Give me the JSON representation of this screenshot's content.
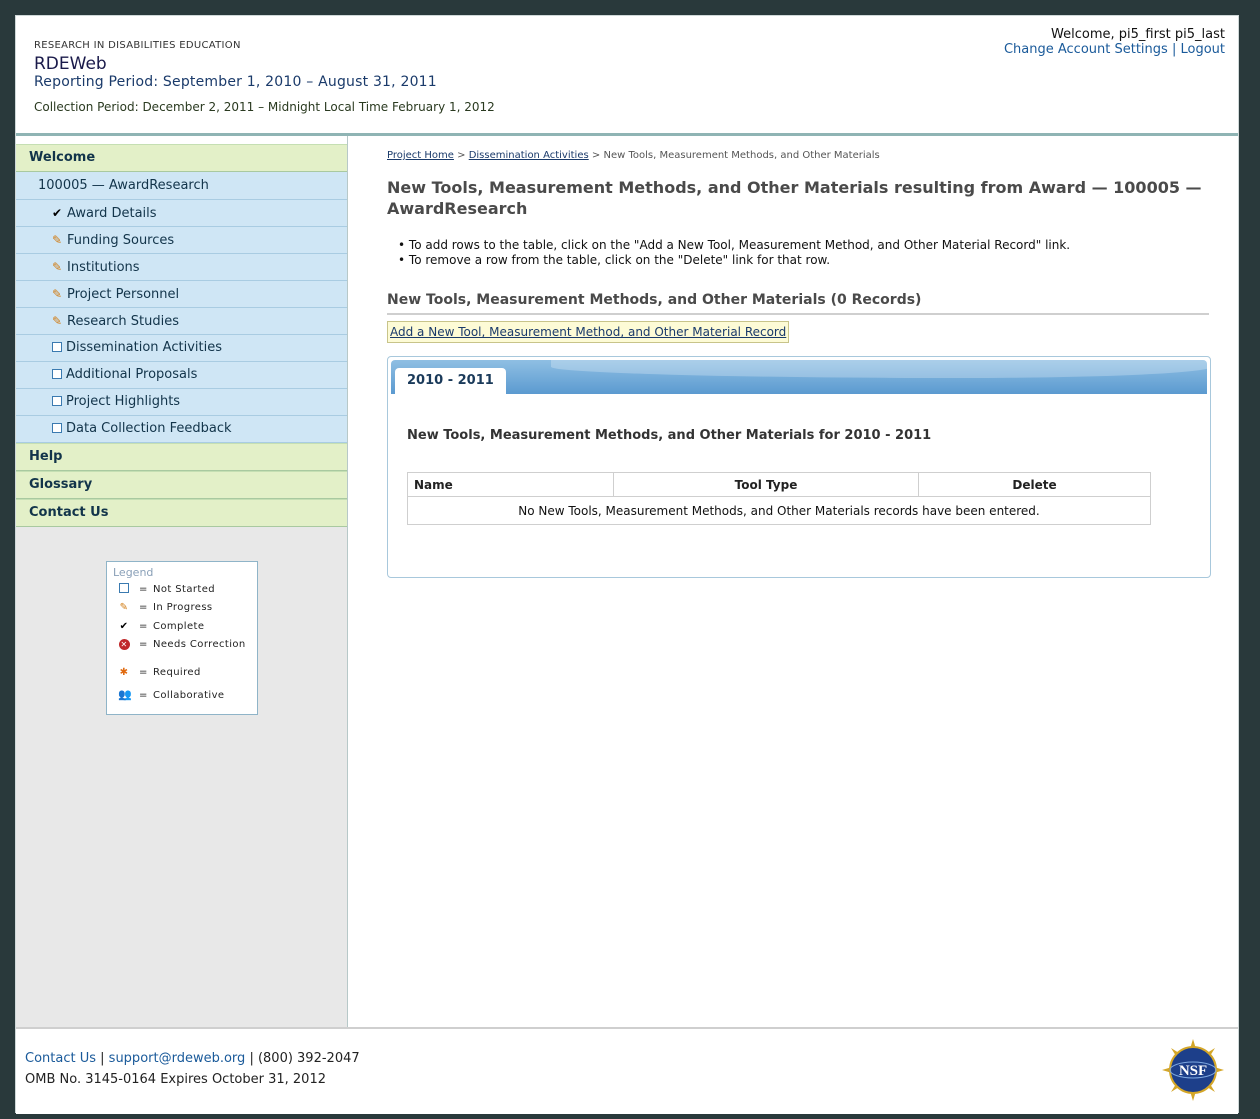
{
  "header": {
    "brand_top": "RESEARCH IN DISABILITIES EDUCATION",
    "brand_name": "RDEWeb",
    "reporting_period": "Reporting Period: September 1, 2010 – August 31, 2011",
    "collection_period": "Collection Period: December 2, 2011 – Midnight Local Time February 1, 2012",
    "welcome": "Welcome, pi5_first pi5_last",
    "change_account": "Change Account Settings",
    "separator": "|",
    "logout": "Logout"
  },
  "sidebar": {
    "welcome": "Welcome",
    "award": "100005 — AwardResearch",
    "items": [
      {
        "label": "Award Details",
        "status": "complete"
      },
      {
        "label": "Funding Sources",
        "status": "in-progress"
      },
      {
        "label": "Institutions",
        "status": "in-progress"
      },
      {
        "label": "Project Personnel",
        "status": "in-progress"
      },
      {
        "label": "Research Studies",
        "status": "in-progress"
      },
      {
        "label": "Dissemination Activities",
        "status": "not-started"
      },
      {
        "label": "Additional Proposals",
        "status": "not-started"
      },
      {
        "label": "Project Highlights",
        "status": "not-started"
      },
      {
        "label": "Data Collection Feedback",
        "status": "not-started"
      }
    ],
    "bottom": [
      "Help",
      "Glossary",
      "Contact Us"
    ]
  },
  "legend": {
    "title": "Legend",
    "eq": "=",
    "rows": [
      "Not Started",
      "In Progress",
      "Complete",
      "Needs Correction",
      "Required",
      "Collaborative"
    ]
  },
  "main": {
    "breadcrumb": {
      "home": "Project Home",
      "sep": ">",
      "dissemination": "Dissemination Activities",
      "current": "New Tools, Measurement Methods, and Other Materials"
    },
    "title": "New Tools, Measurement Methods, and Other Materials resulting from Award — 100005 — AwardResearch",
    "bullets": [
      "To add rows to the table, click on the \"Add a New Tool, Measurement Method, and Other Material Record\" link.",
      "To remove a row from the table, click on the \"Delete\" link for that row."
    ],
    "section_heading": "New Tools, Measurement Methods, and Other Materials (0 Records)",
    "add_link": "Add a New Tool, Measurement Method, and Other Material Record",
    "tab_label": "2010 - 2011",
    "panel_heading": "New Tools, Measurement Methods, and Other Materials for 2010 - 2011",
    "table": {
      "columns": [
        "Name",
        "Tool Type",
        "Delete"
      ],
      "empty_message": "No New Tools, Measurement Methods, and Other Materials records have been entered."
    }
  },
  "footer": {
    "contact": "Contact Us",
    "sep": "|",
    "email": "support@rdeweb.org",
    "phone": "| (800) 392-2047",
    "omb": "OMB No. 3145-0164 Expires October 31, 2012",
    "logo_text": "NSF"
  },
  "colors": {
    "nav_green": "#e3f0c8",
    "nav_blue": "#cfe6f5",
    "link_blue": "#1a5a9a",
    "tab_blue": "#5b9ad0"
  }
}
